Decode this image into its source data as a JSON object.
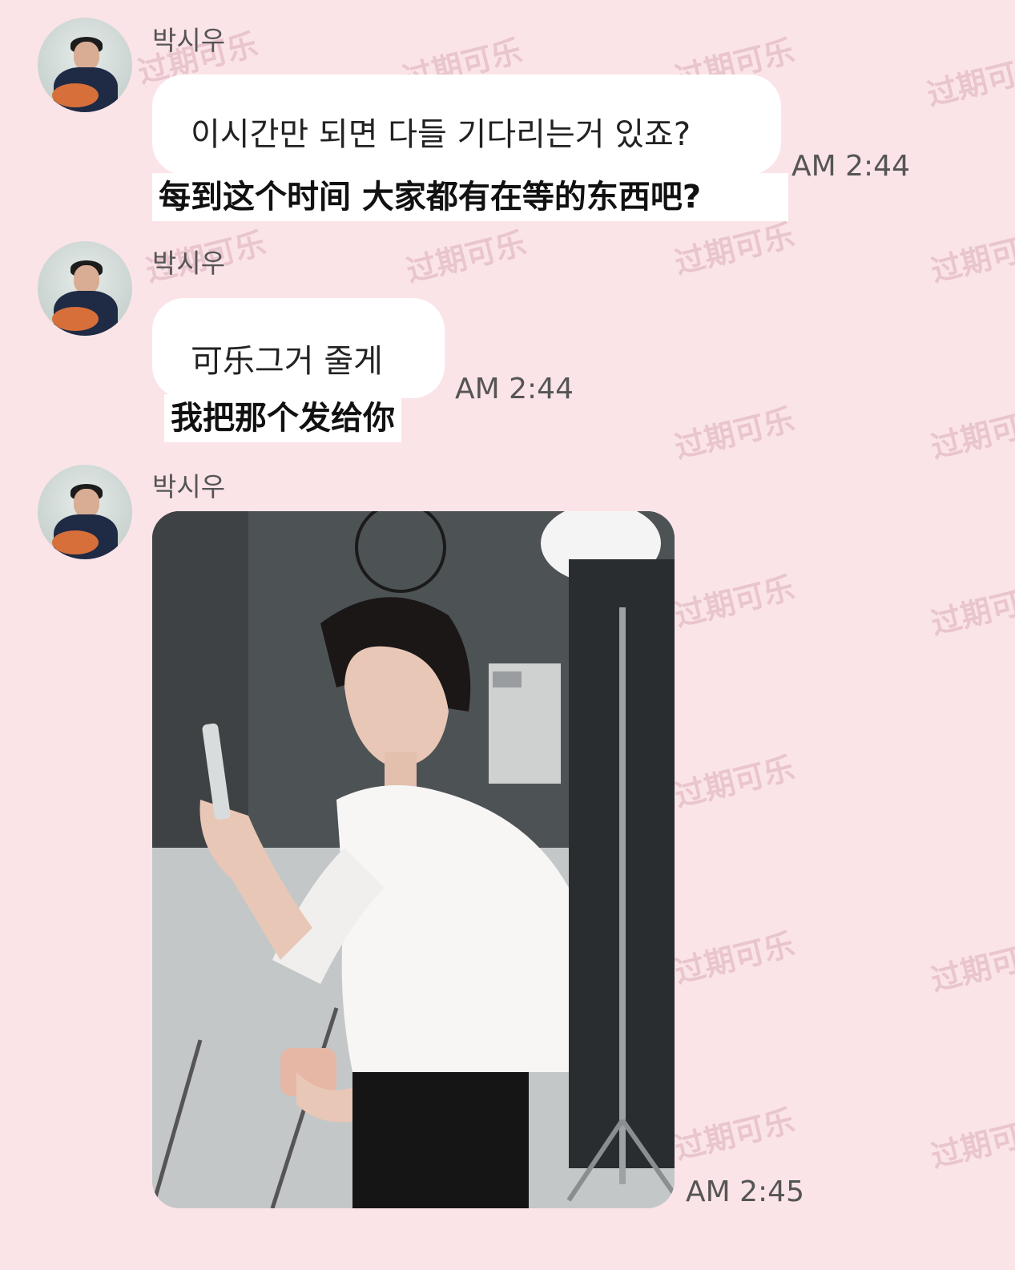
{
  "watermark": "过期可乐",
  "messages": [
    {
      "sender": "박시우",
      "text": "이시간만 되면 다들 기다리는거 있죠?",
      "translation": "每到这个时间 大家都有在等的东西吧?",
      "time": "AM 2:44"
    },
    {
      "sender": "박시우",
      "text": "可乐그거 줄게",
      "translation": "我把那个发给你",
      "time": "AM 2:44"
    },
    {
      "sender": "박시우",
      "time": "AM 2:45"
    }
  ]
}
